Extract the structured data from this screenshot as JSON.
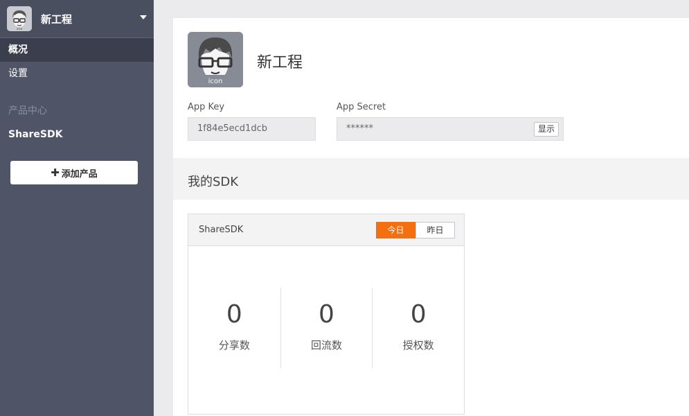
{
  "sidebar": {
    "project_name": "新工程",
    "logo_text": "icon",
    "items": [
      {
        "label": "概况",
        "active": true
      },
      {
        "label": "设置",
        "active": false
      }
    ],
    "section_label": "产品中心",
    "product_item": "ShareSDK",
    "add_button": "添加产品"
  },
  "main": {
    "app_icon_text": "icon",
    "app_title": "新工程",
    "app_key_label": "App Key",
    "app_key_value": "1f84e5ecd1dcb",
    "app_secret_label": "App Secret",
    "app_secret_value": "******",
    "show_button": "显示",
    "sdk_section_title": "我的SDK",
    "card": {
      "title": "ShareSDK",
      "toggle": [
        {
          "label": "今日",
          "active": true
        },
        {
          "label": "昨日",
          "active": false
        }
      ],
      "stats": [
        {
          "value": "0",
          "label": "分享数"
        },
        {
          "value": "0",
          "label": "回流数"
        },
        {
          "value": "0",
          "label": "授权数"
        }
      ]
    }
  },
  "colors": {
    "sidebar_bg": "#4f5466",
    "active_bg": "#3b3f4d",
    "accent": "#f36f10"
  }
}
